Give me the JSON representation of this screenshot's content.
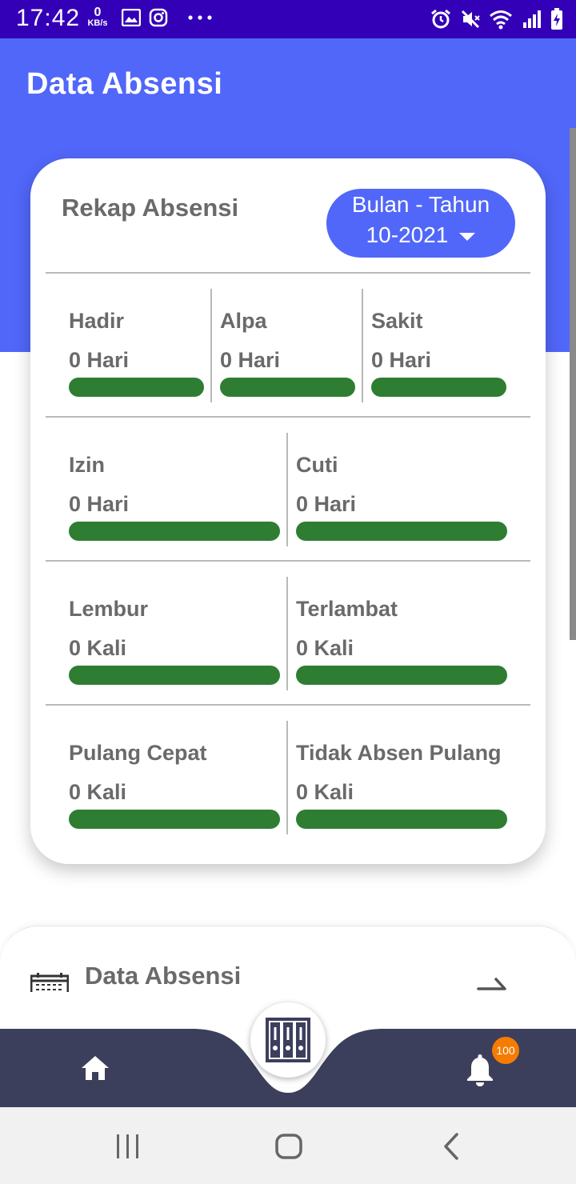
{
  "status_bar": {
    "time": "17:42",
    "net_speed_value": "0",
    "net_speed_unit": "KB/s",
    "icons": [
      "image-icon",
      "instagram-icon",
      "more-dots-icon",
      "alarm-icon",
      "mute-icon",
      "wifi-icon",
      "signal-icon",
      "battery-charging-icon"
    ]
  },
  "header": {
    "title": "Data Absensi"
  },
  "colors": {
    "accent": "#5167f9",
    "status_bar": "#3300b8",
    "bar_fill": "#2e7d32",
    "nav_bar": "#3c3f5c",
    "badge": "#f57c00"
  },
  "recap": {
    "title": "Rekap Absensi",
    "period": {
      "label": "Bulan - Tahun",
      "value": "10-2021"
    },
    "stats": [
      {
        "label": "Hadir",
        "value": "0 Hari"
      },
      {
        "label": "Alpa",
        "value": "0 Hari"
      },
      {
        "label": "Sakit",
        "value": "0 Hari"
      },
      {
        "label": "Izin",
        "value": "0 Hari"
      },
      {
        "label": "Cuti",
        "value": "0 Hari"
      },
      {
        "label": "Lembur",
        "value": "0 Kali"
      },
      {
        "label": "Terlambat",
        "value": "0 Kali"
      },
      {
        "label": "Pulang Cepat",
        "value": "0 Kali"
      },
      {
        "label": "Tidak Absen Pulang",
        "value": "0 Kali"
      }
    ]
  },
  "menu": {
    "title": "Data Absensi",
    "icon": "calendar-icon"
  },
  "bottom_nav": {
    "home_icon": "home-icon",
    "center_icon": "archive-files-icon",
    "bell_icon": "bell-icon",
    "badge_count": "100"
  },
  "system_nav": [
    "recent-apps-icon",
    "home-circle-icon",
    "back-icon"
  ]
}
